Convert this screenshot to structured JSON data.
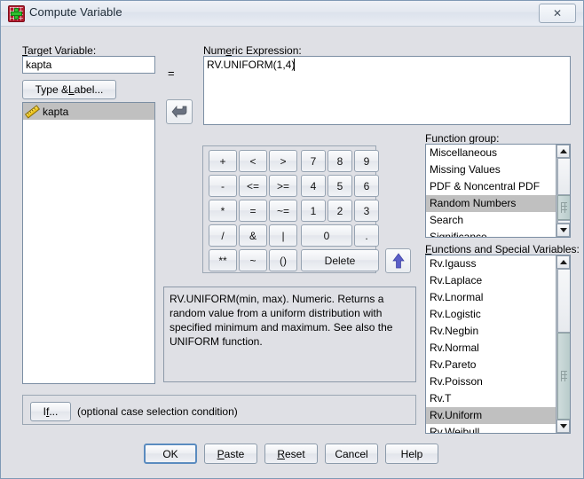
{
  "window": {
    "title": "Compute Variable",
    "icon": "compute-variable-icon",
    "close_label": "✕"
  },
  "target": {
    "label": "Target Variable:",
    "label_mnemonic": "T",
    "value": "kapta",
    "type_label_button": "Type & Label...",
    "equals_sign": "="
  },
  "variable_list": {
    "items": [
      {
        "name": "kapta",
        "icon": "ruler-icon",
        "selected": true
      }
    ]
  },
  "expression": {
    "label": "Numeric Expression:",
    "value": "RV.UNIFORM(1,4)",
    "caret": "|"
  },
  "arrows": {
    "insert_variable": "↵",
    "insert_function": "↑"
  },
  "keypad": {
    "rows": [
      [
        "+",
        "<",
        ">",
        "7",
        "8",
        "9"
      ],
      [
        "-",
        "<=",
        ">=",
        "4",
        "5",
        "6"
      ],
      [
        "*",
        "=",
        "~=",
        "1",
        "2",
        "3"
      ],
      [
        "/",
        "&",
        "|",
        "0",
        "."
      ],
      [
        "**",
        "~",
        "()",
        "Delete"
      ]
    ]
  },
  "function_group": {
    "label": "Function group:",
    "label_mnemonic": "g",
    "items": [
      "Miscellaneous",
      "Missing Values",
      "PDF & Noncentral PDF",
      "Random Numbers",
      "Search",
      "Significance"
    ],
    "selected": "Random Numbers"
  },
  "functions": {
    "label": "Functions and Special Variables:",
    "label_mnemonic": "F",
    "items": [
      "Rv.Igauss",
      "Rv.Laplace",
      "Rv.Lnormal",
      "Rv.Logistic",
      "Rv.Negbin",
      "Rv.Normal",
      "Rv.Pareto",
      "Rv.Poisson",
      "Rv.T",
      "Rv.Uniform",
      "Rv.Weibull"
    ],
    "selected": "Rv.Uniform"
  },
  "description": {
    "text": "RV.UNIFORM(min, max). Numeric. Returns a random value from a uniform distribution with specified minimum and maximum. See also the UNIFORM function."
  },
  "condition": {
    "button": "If...",
    "button_mnemonic": "f",
    "hint": "(optional case selection condition)"
  },
  "dialog_buttons": [
    {
      "label": "OK",
      "mnemonic": "",
      "default": true
    },
    {
      "label": "Paste",
      "mnemonic": "P",
      "default": false
    },
    {
      "label": "Reset",
      "mnemonic": "R",
      "default": false
    },
    {
      "label": "Cancel",
      "mnemonic": "C",
      "default": false
    },
    {
      "label": "Help",
      "mnemonic": "H",
      "default": false
    }
  ],
  "colors": {
    "dialog_bg": "#dfe0e5",
    "selection": "#c0c0c0",
    "accent_blue": "#5a8bbf",
    "arrow_blue": "#5b5fc7",
    "icon_red": "#b01a2c",
    "icon_green": "#2fbf2f"
  }
}
